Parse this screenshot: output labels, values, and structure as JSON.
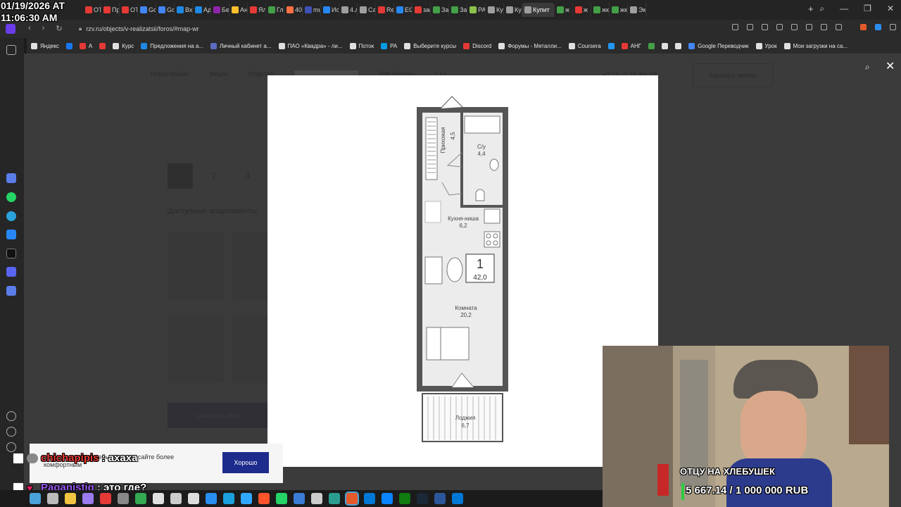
{
  "browser": {
    "tabs": [
      {
        "label": "OT",
        "icon": "youtube-icon",
        "color": "#e53935"
      },
      {
        "label": "Пр",
        "icon": "youtube-icon",
        "color": "#e53935"
      },
      {
        "label": "OT",
        "icon": "youtube-icon",
        "color": "#e53935"
      },
      {
        "label": "Go",
        "icon": "google-docs-icon",
        "color": "#4285f4"
      },
      {
        "label": "Go",
        "icon": "google-docs-icon",
        "color": "#4285f4"
      },
      {
        "label": "Вхс",
        "icon": "mail-icon",
        "color": "#1e88e5"
      },
      {
        "label": "Ад",
        "icon": "mail-icon",
        "color": "#1e88e5"
      },
      {
        "label": "Бет",
        "icon": "site-icon",
        "color": "#8e24aa"
      },
      {
        "label": "Ан",
        "icon": "site-icon",
        "color": "#fbc02d"
      },
      {
        "label": "Ял",
        "icon": "site-icon",
        "color": "#e53935"
      },
      {
        "label": "Гл",
        "icon": "site-icon",
        "color": "#43a047"
      },
      {
        "label": "40",
        "icon": "site-icon",
        "color": "#ff7043"
      },
      {
        "label": "mu",
        "icon": "site-icon",
        "color": "#3f51b5"
      },
      {
        "label": "Ис",
        "icon": "vk-icon",
        "color": "#2787f5"
      },
      {
        "label": "4.л",
        "icon": "site-icon",
        "color": "#9e9e9e"
      },
      {
        "label": "Са",
        "icon": "site-icon",
        "color": "#9e9e9e"
      },
      {
        "label": "Rec",
        "icon": "site-icon",
        "color": "#e53935"
      },
      {
        "label": "EG",
        "icon": "vk-icon",
        "color": "#2787f5"
      },
      {
        "label": "зас",
        "icon": "site-icon",
        "color": "#e53935"
      },
      {
        "label": "За",
        "icon": "site-icon",
        "color": "#43a047"
      },
      {
        "label": "За",
        "icon": "site-icon",
        "color": "#43a047"
      },
      {
        "label": "PA",
        "icon": "site-icon",
        "color": "#8bc34a"
      },
      {
        "label": "Ку",
        "icon": "site-icon",
        "color": "#9e9e9e"
      },
      {
        "label": "Ку",
        "icon": "site-icon",
        "color": "#9e9e9e"
      },
      {
        "label": "Купит",
        "icon": "site-icon",
        "color": "#9e9e9e",
        "active": true
      },
      {
        "label": "ж",
        "icon": "site-icon",
        "color": "#43a047"
      },
      {
        "label": "ж",
        "icon": "site-icon",
        "color": "#e53935"
      },
      {
        "label": "жк",
        "icon": "site-icon",
        "color": "#43a047"
      },
      {
        "label": "жк",
        "icon": "site-icon",
        "color": "#43a047"
      },
      {
        "label": "Эк",
        "icon": "site-icon",
        "color": "#9e9e9e"
      }
    ],
    "new_tab_label": "+",
    "url": "rzv.ru/objects/v-realizatsii/foros/#map-wr"
  },
  "bookmarks": [
    {
      "label": "Яндекс",
      "color": "#e0e0e0"
    },
    {
      "label": "",
      "color": "#1877f2"
    },
    {
      "label": "A",
      "color": "#e53935"
    },
    {
      "label": "",
      "color": "#e53935"
    },
    {
      "label": "Курс",
      "color": "#e0e0e0"
    },
    {
      "label": "Предложения на а...",
      "color": "#1e88e5"
    },
    {
      "label": "Личный кабинет а...",
      "color": "#5c6bc0"
    },
    {
      "label": "ПАО «Квадра» - ли...",
      "color": "#e0e0e0"
    },
    {
      "label": "Поток",
      "color": "#e0e0e0"
    },
    {
      "label": "PA",
      "color": "#039be5"
    },
    {
      "label": "Выберите курсы",
      "color": "#e0e0e0"
    },
    {
      "label": "Discord",
      "color": "#e53935"
    },
    {
      "label": "Форумы - Металли...",
      "color": "#e0e0e0"
    },
    {
      "label": "Coursera",
      "color": "#e0e0e0"
    },
    {
      "label": "",
      "color": "#2196f3"
    },
    {
      "label": "АНГ",
      "color": "#e53935"
    },
    {
      "label": "",
      "color": "#43a047"
    },
    {
      "label": "",
      "color": "#e0e0e0"
    },
    {
      "label": "",
      "color": "#e0e0e0"
    },
    {
      "label": "Google Переводчик",
      "color": "#4285f4"
    },
    {
      "label": "Урок",
      "color": "#e0e0e0"
    },
    {
      "label": "Мои загрузки на са...",
      "color": "#e0e0e0"
    }
  ],
  "site": {
    "nav": [
      "Новостройки",
      "Акции",
      "Отделка",
      "Семья заботливых",
      "Все бренды",
      "• • •"
    ],
    "phone": "+7 (4...) 21-88-65",
    "order_button": "Заказать звонок",
    "pages": [
      "1",
      "2",
      "3"
    ],
    "available_title": "Доступные апартаменты",
    "show_button": "Смотреть квар..."
  },
  "floorplan": {
    "rooms": {
      "hallway": {
        "name": "Прихожая",
        "area": "4,5"
      },
      "bathroom": {
        "name": "С/у",
        "area": "4,4"
      },
      "kitchen": {
        "name": "Кухня-ниша",
        "area": "6,2"
      },
      "room": {
        "name": "Комната",
        "area": "20,2"
      },
      "loggia": {
        "name": "Лоджия",
        "area": "6,7"
      }
    },
    "badge": {
      "rooms": "1",
      "total_area": "42,0"
    }
  },
  "cookie": {
    "text": "...сделать ваше пребывание на сайте более комфортным",
    "button": "Хорошо"
  },
  "overlay": {
    "date": "01/19/2026 AT",
    "time": "11:06:30 AM",
    "chat": [
      {
        "user": "chichapipis",
        "user_color": "#e53935",
        "message": ": ахаха"
      },
      {
        "user": "Paganistiq",
        "user_color": "#9b59f0",
        "message": ": это где?"
      }
    ],
    "donation_title": "ОТЦУ НА ХЛЕБУШЕК",
    "donation_amount": "5 667.14 / 1 000 000 RUB",
    "donation_progress": 0.0057
  },
  "taskbar": [
    "windows",
    "search",
    "files",
    "premiere",
    "yandex",
    "calc",
    "chrome",
    "browser",
    "settings",
    "gear",
    "vscode",
    "telegram",
    "ps",
    "brave",
    "whatsapp",
    "browser2",
    "tool",
    "network",
    "stream",
    "edge",
    "edge2",
    "xbox",
    "steam",
    "word",
    "edge3"
  ]
}
